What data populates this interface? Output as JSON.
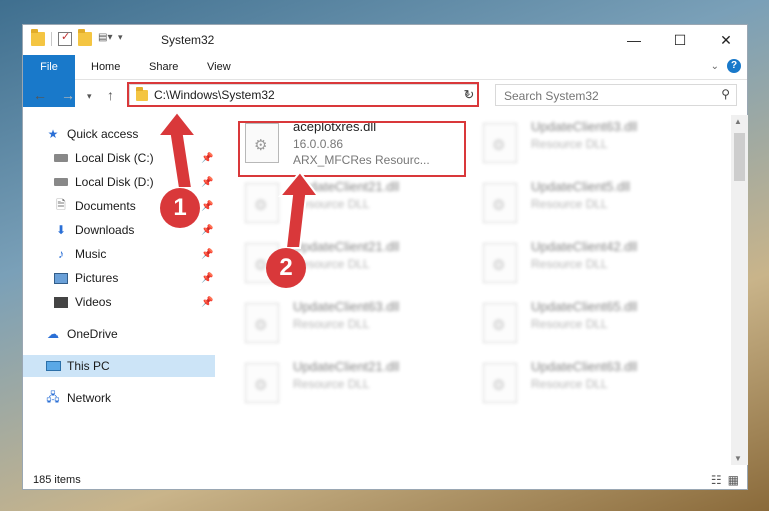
{
  "window": {
    "title": "System32"
  },
  "title_bar": {
    "minimize": "—",
    "maximize": "☐",
    "close": "✕"
  },
  "ribbon": {
    "tabs": [
      "File",
      "Home",
      "Share",
      "View"
    ]
  },
  "nav": {
    "address": "C:\\Windows\\System32",
    "search_placeholder": "Search System32"
  },
  "sidebar": {
    "items": [
      {
        "label": "Quick access",
        "icon": "star-icon"
      },
      {
        "label": "Local Disk (C:)",
        "icon": "drive-icon",
        "pinned": true
      },
      {
        "label": "Local Disk (D:)",
        "icon": "drive-icon",
        "pinned": true
      },
      {
        "label": "Documents",
        "icon": "documents-icon",
        "pinned": true
      },
      {
        "label": "Downloads",
        "icon": "downloads-icon",
        "pinned": true
      },
      {
        "label": "Music",
        "icon": "music-icon",
        "pinned": true
      },
      {
        "label": "Pictures",
        "icon": "pictures-icon",
        "pinned": true
      },
      {
        "label": "Videos",
        "icon": "videos-icon",
        "pinned": true
      },
      {
        "label": "OneDrive",
        "icon": "cloud-icon"
      },
      {
        "label": "This PC",
        "icon": "computer-icon",
        "selected": true
      },
      {
        "label": "Network",
        "icon": "network-icon"
      }
    ]
  },
  "files": [
    {
      "name": "aceplotxres.dll",
      "version": "16.0.0.86",
      "description": "ARX_MFCRes   Resourc...",
      "highlighted": true
    },
    {
      "name": "UpdateClient63.dll",
      "description": "Resource DLL"
    },
    {
      "name": "UpdateClient21.dll",
      "description": "Resource DLL"
    },
    {
      "name": "UpdateClient5.dll",
      "description": "Resource DLL"
    },
    {
      "name": "UpdateClient21.dll",
      "description": "Resource DLL"
    },
    {
      "name": "UpdateClient42.dll",
      "description": "Resource DLL"
    },
    {
      "name": "UpdateClient63.dll",
      "description": "Resource DLL"
    },
    {
      "name": "UpdateClient65.dll",
      "description": "Resource DLL"
    },
    {
      "name": "UpdateClient21.dll",
      "description": "Resource DLL"
    },
    {
      "name": "UpdateClient63.dll",
      "description": "Resource DLL"
    }
  ],
  "status": {
    "item_count": "185 items"
  },
  "callouts": [
    "1",
    "2"
  ],
  "colors": {
    "accent": "#1979ca",
    "highlight": "#d9383a",
    "selected": "#cce4f7"
  }
}
